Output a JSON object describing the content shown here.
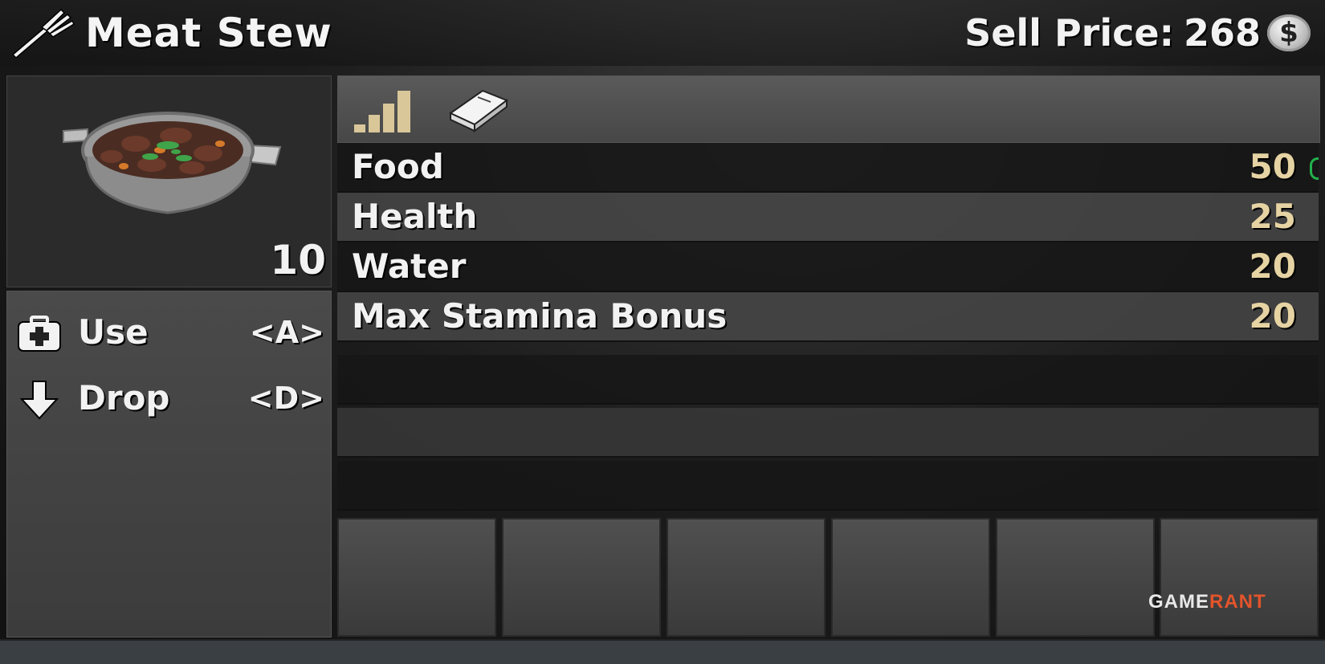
{
  "header": {
    "item_name": "Meat Stew",
    "sell_price_label": "Sell Price:",
    "sell_price_value": "268",
    "currency_symbol": "$",
    "item_icon": "fork-icon"
  },
  "item_panel": {
    "count": "10",
    "image": "meat-stew-pot"
  },
  "actions": [
    {
      "icon": "medkit-icon",
      "label": "Use",
      "key": "<A>"
    },
    {
      "icon": "arrow-down-icon",
      "label": "Drop",
      "key": "<D>"
    }
  ],
  "tabs": [
    {
      "icon": "signal-bars-icon"
    },
    {
      "icon": "book-icon"
    }
  ],
  "stats": [
    {
      "name": "Food",
      "value": "50"
    },
    {
      "name": "Health",
      "value": "25"
    },
    {
      "name": "Water",
      "value": "20"
    },
    {
      "name": "Max Stamina Bonus",
      "value": "20"
    }
  ],
  "watermark": {
    "part1": "GAME",
    "part2": "RANT"
  },
  "colors": {
    "value_color": "#e6d3a3",
    "accent_green": "#22b14c",
    "watermark_orange": "#e3542b"
  }
}
